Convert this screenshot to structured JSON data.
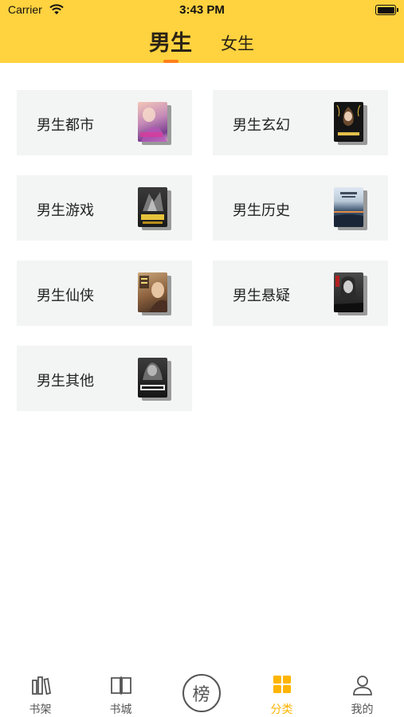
{
  "status_bar": {
    "carrier": "Carrier",
    "time": "3:43 PM"
  },
  "header": {
    "tabs": [
      {
        "label": "男生",
        "active": true
      },
      {
        "label": "女生",
        "active": false
      }
    ],
    "background_color": "#FFD23F",
    "indicator_color": "#FF7F1A"
  },
  "categories": [
    {
      "label": "男生都市",
      "cover": "urban"
    },
    {
      "label": "男生玄幻",
      "cover": "fantasy"
    },
    {
      "label": "男生游戏",
      "cover": "game"
    },
    {
      "label": "男生历史",
      "cover": "history"
    },
    {
      "label": "男生仙侠",
      "cover": "xianxia"
    },
    {
      "label": "男生悬疑",
      "cover": "mystery"
    },
    {
      "label": "男生其他",
      "cover": "other"
    }
  ],
  "tabbar": {
    "items": [
      {
        "label": "书架",
        "icon": "bookshelf-icon",
        "active": false
      },
      {
        "label": "书城",
        "icon": "open-book-icon",
        "active": false
      },
      {
        "label": "榜",
        "icon": "ranking-icon",
        "active": false
      },
      {
        "label": "分类",
        "icon": "grid-icon",
        "active": true
      },
      {
        "label": "我的",
        "icon": "person-icon",
        "active": false
      }
    ],
    "active_color": "#FFB400"
  }
}
